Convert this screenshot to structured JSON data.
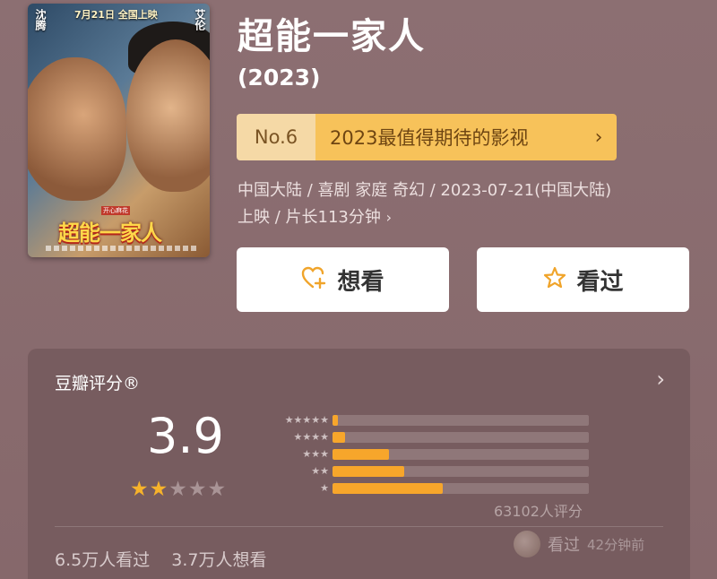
{
  "poster": {
    "release_banner": "7月21日 全国上映",
    "actor_left": "沈腾",
    "actor_right": "艾伦",
    "poster_tag": "开心麻花",
    "poster_title": "超能一家人"
  },
  "movie": {
    "title": "超能一家人",
    "year": "(2023)",
    "rank_no": "No.6",
    "rank_text": "2023最值得期待的影视",
    "rank_chevron": "›",
    "meta_line1": "中国大陆 / 喜剧 家庭 奇幻 / 2023-07-21(中国大陆)",
    "meta_line2": "上映 / 片长113分钟",
    "meta_chevron": "›"
  },
  "actions": {
    "want_label": "想看",
    "want_icon": "heart-plus-icon",
    "seen_label": "看过",
    "seen_icon": "star-outline-icon"
  },
  "rating": {
    "label": "豆瓣评分®",
    "chevron": "›",
    "score": "3.9",
    "stars_filled": 2,
    "stars_total": 5,
    "votes": "63102人评分",
    "distribution": [
      {
        "stars": "★★★★★",
        "fraction": 0.02
      },
      {
        "stars": "★★★★",
        "fraction": 0.05
      },
      {
        "stars": "★★★",
        "fraction": 0.22
      },
      {
        "stars": "★★",
        "fraction": 0.28
      },
      {
        "stars": "★",
        "fraction": 0.43
      }
    ],
    "watched_count": "6.5万人看过",
    "want_count": "3.7万人想看",
    "recent_action": "看过",
    "recent_time": "42分钟前"
  },
  "colors": {
    "background": "#8a6d70",
    "accent": "#f7a62b",
    "badge": "#f7c25a"
  }
}
